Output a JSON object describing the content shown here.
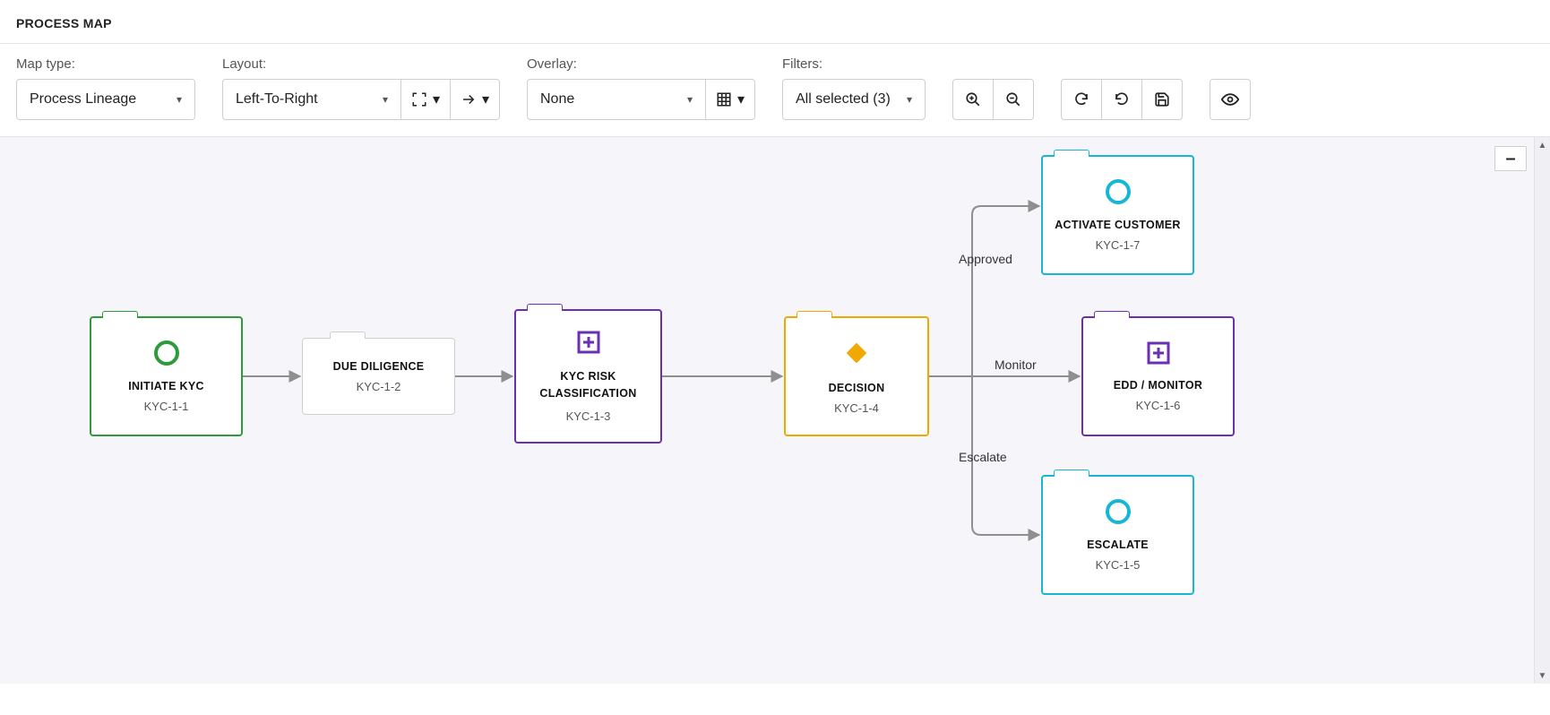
{
  "header": {
    "title": "PROCESS MAP"
  },
  "toolbar": {
    "mapType": {
      "label": "Map type:",
      "value": "Process Lineage"
    },
    "layout": {
      "label": "Layout:",
      "value": "Left-To-Right"
    },
    "overlay": {
      "label": "Overlay:",
      "value": "None"
    },
    "filters": {
      "label": "Filters:",
      "value": "All selected (3)"
    }
  },
  "canvas": {
    "minusButton": "–",
    "nodes": {
      "initiate": {
        "title": "INITIATE KYC",
        "sub": "KYC-1-1",
        "color": "#2e9b3a"
      },
      "dueDiligence": {
        "title": "DUE DILIGENCE",
        "sub": "KYC-1-2",
        "color": "#cfcfcf"
      },
      "riskClass": {
        "title": "KYC RISK CLASSIFICATION",
        "sub": "KYC-1-3",
        "color": "#6b2fb3"
      },
      "decision": {
        "title": "DECISION",
        "sub": "KYC-1-4",
        "color": "#f0a900"
      },
      "escalate": {
        "title": "ESCALATE",
        "sub": "KYC-1-5",
        "color": "#17b6d6"
      },
      "eddMonitor": {
        "title": "EDD / MONITOR",
        "sub": "KYC-1-6",
        "color": "#6b2fb3"
      },
      "activate": {
        "title": "ACTIVATE CUSTOMER",
        "sub": "KYC-1-7",
        "color": "#17b6d6"
      }
    },
    "edges": {
      "approved": "Approved",
      "monitor": "Monitor",
      "escalate": "Escalate"
    }
  }
}
